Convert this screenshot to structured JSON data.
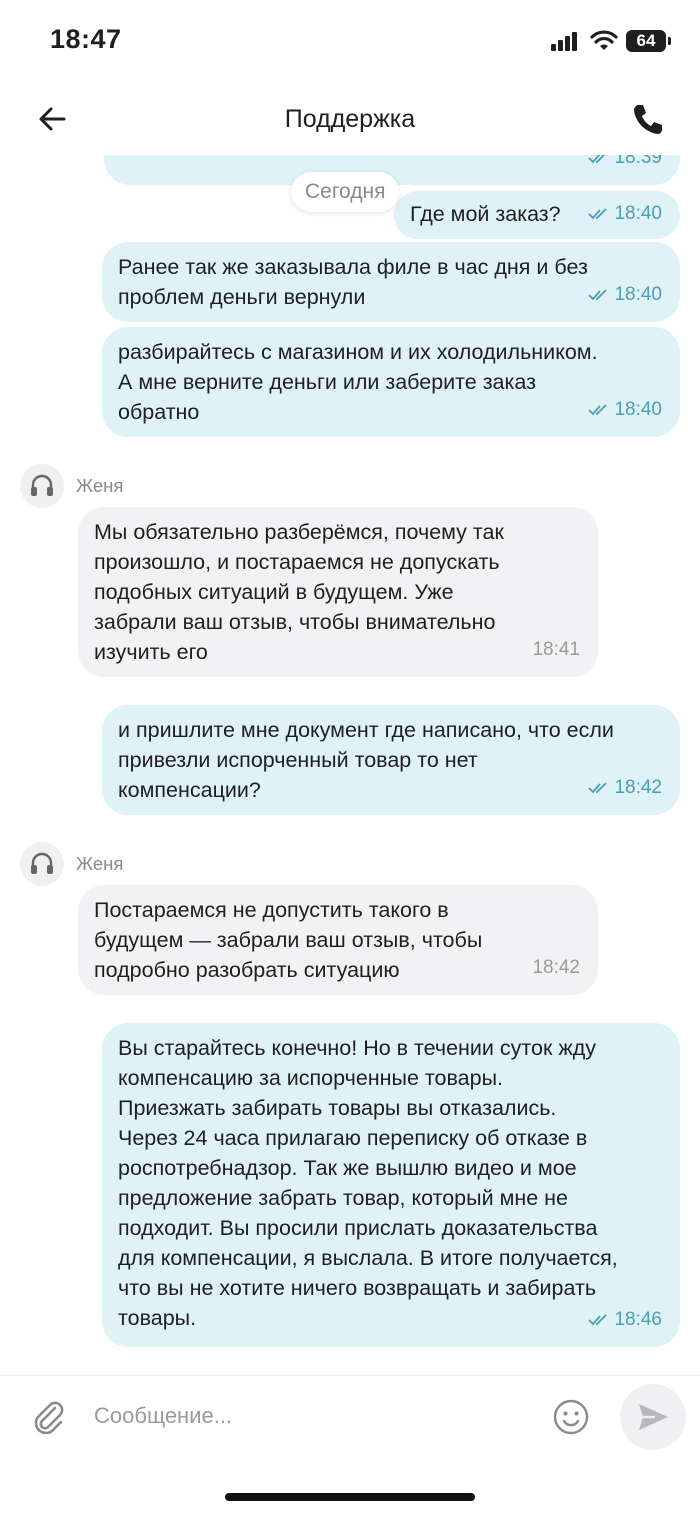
{
  "status_bar": {
    "time": "18:47",
    "battery": "64"
  },
  "header": {
    "title": "Поддержка",
    "back_icon": "arrow-left-icon",
    "phone_icon": "phone-icon"
  },
  "chat": {
    "date_divider": "Сегодня",
    "messages": [
      {
        "direction": "out",
        "text": "",
        "time": "18:39",
        "read": true
      },
      {
        "direction": "out",
        "text": "Где мой заказ?",
        "time": "18:40",
        "read": true
      },
      {
        "direction": "out",
        "text": "Ранее так же заказывала филе в час дня и без\nпроблем деньги вернули",
        "time": "18:40",
        "read": true
      },
      {
        "direction": "out",
        "text": "разбирайтесь с магазином и их холодильником.\nА мне верните деньги или заберите заказ\nобратно",
        "time": "18:40",
        "read": true
      },
      {
        "direction": "in",
        "sender": "Женя",
        "text": "Мы обязательно разберёмся, почему так\nпроизошло, и постараемся не допускать\nподобных ситуаций в будущем. Уже\nзабрали ваш отзыв, чтобы внимательно\nизучить его",
        "time": "18:41"
      },
      {
        "direction": "out",
        "text": "и пришлите мне документ где написано, что если\nпривезли испорченный товар то нет\nкомпенсации?",
        "time": "18:42",
        "read": true
      },
      {
        "direction": "in",
        "sender": "Женя",
        "text": "Постараемся не допустить такого в\nбудущем — забрали ваш отзыв, чтобы\nподробно разобрать ситуацию",
        "time": "18:42"
      },
      {
        "direction": "out",
        "text": "Вы старайтесь конечно! Но в течении суток жду\nкомпенсацию за испорченные товары.\nПриезжать забирать товары вы отказались.\nЧерез 24 часа прилагаю переписку об отказе в\nроспотребнадзор. Так же вышлю видео и мое\nпредложение забрать товар, который мне не\nподходит. Вы просили прислать доказательства\nдля компенсации, я выслала. В итоге получается,\nчто вы не хотите ничего возвращать и забирать\nтовары.",
        "time": "18:46",
        "read": true
      }
    ]
  },
  "composer": {
    "placeholder": "Сообщение...",
    "attach_icon": "paperclip-icon",
    "emoji_icon": "smile-icon",
    "send_icon": "send-icon"
  },
  "colors": {
    "outgoing_bubble": "#dff2f7",
    "incoming_bubble": "#f2f2f4",
    "read_check": "#4a9fb0"
  }
}
